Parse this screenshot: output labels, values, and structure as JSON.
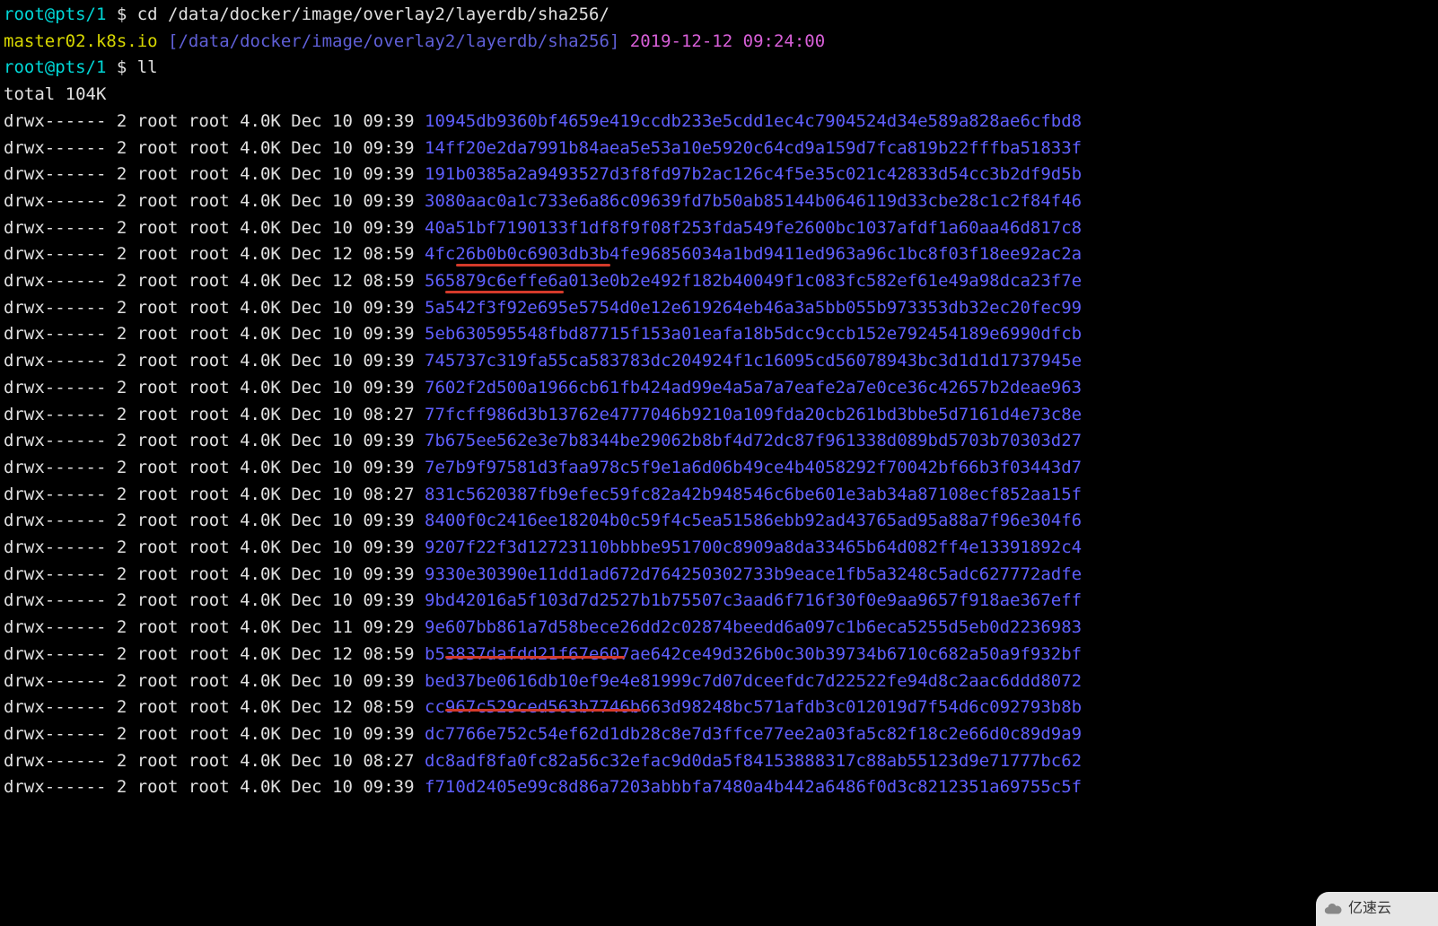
{
  "prompt1": {
    "userhost": "root@pts/1",
    "dollar": " $ ",
    "cmd": "cd /data/docker/image/overlay2/layerdb/sha256/"
  },
  "status": {
    "host": "master02.k8s.io",
    "path": " [/data/docker/image/overlay2/layerdb/sha256]",
    "ts": " 2019-12-12 09:24:00"
  },
  "prompt2": {
    "userhost": "root@pts/1",
    "dollar": " $ ",
    "cmd": "ll"
  },
  "total": "total 104K",
  "cols_prefix": "drwx------ 2 root root 4.0K ",
  "rows": [
    {
      "dt": "Dec 10 09:39 ",
      "h": "10945db9360bf4659e419ccdb233e5cdd1ec4c7904524d34e589a828ae6cfbd8"
    },
    {
      "dt": "Dec 10 09:39 ",
      "h": "14ff20e2da7991b84aea5e53a10e5920c64cd9a159d7fca819b22fffba51833f"
    },
    {
      "dt": "Dec 10 09:39 ",
      "h": "191b0385a2a9493527d3f8fd97b2ac126c4f5e35c021c42833d54cc3b2df9d5b"
    },
    {
      "dt": "Dec 10 09:39 ",
      "h": "3080aac0a1c733e6a86c09639fd7b50ab85144b0646119d33cbe28c1c2f84f46"
    },
    {
      "dt": "Dec 10 09:39 ",
      "h": "40a51bf7190133f1df8f9f08f253fda549fe2600bc1037afdf1a60aa46d817c8"
    },
    {
      "dt": "Dec 12 08:59 ",
      "h": "4fc26b0b0c6903db3b4fe96856034a1bd9411ed963a96c1bc8f03f18ee92ac2a"
    },
    {
      "dt": "Dec 12 08:59 ",
      "h": "565879c6effe6a013e0b2e492f182b40049f1c083fc582ef61e49a98dca23f7e"
    },
    {
      "dt": "Dec 10 09:39 ",
      "h": "5a542f3f92e695e5754d0e12e619264eb46a3a5bb055b973353db32ec20fec99"
    },
    {
      "dt": "Dec 10 09:39 ",
      "h": "5eb630595548fbd87715f153a01eafa18b5dcc9ccb152e792454189e6990dfcb"
    },
    {
      "dt": "Dec 10 09:39 ",
      "h": "745737c319fa55ca583783dc204924f1c16095cd56078943bc3d1d1d1737945e"
    },
    {
      "dt": "Dec 10 09:39 ",
      "h": "7602f2d500a1966cb61fb424ad99e4a5a7a7eafe2a7e0ce36c42657b2deae963"
    },
    {
      "dt": "Dec 10 08:27 ",
      "h": "77fcff986d3b13762e4777046b9210a109fda20cb261bd3bbe5d7161d4e73c8e"
    },
    {
      "dt": "Dec 10 09:39 ",
      "h": "7b675ee562e3e7b8344be29062b8bf4d72dc87f961338d089bd5703b70303d27"
    },
    {
      "dt": "Dec 10 09:39 ",
      "h": "7e7b9f97581d3faa978c5f9e1a6d06b49ce4b4058292f70042bf66b3f03443d7"
    },
    {
      "dt": "Dec 10 08:27 ",
      "h": "831c5620387fb9efec59fc82a42b948546c6be601e3ab34a87108ecf852aa15f"
    },
    {
      "dt": "Dec 10 09:39 ",
      "h": "8400f0c2416ee18204b0c59f4c5ea51586ebb92ad43765ad95a88a7f96e304f6"
    },
    {
      "dt": "Dec 10 09:39 ",
      "h": "9207f22f3d12723110bbbbe951700c8909a8da33465b64d082ff4e13391892c4"
    },
    {
      "dt": "Dec 10 09:39 ",
      "h": "9330e30390e11dd1ad672d764250302733b9eace1fb5a3248c5adc627772adfe"
    },
    {
      "dt": "Dec 10 09:39 ",
      "h": "9bd42016a5f103d7d2527b1b75507c3aad6f716f30f0e9aa9657f918ae367eff"
    },
    {
      "dt": "Dec 11 09:29 ",
      "h": "9e607bb861a7d58bece26dd2c02874beedd6a097c1b6eca5255d5eb0d2236983"
    },
    {
      "dt": "Dec 12 08:59 ",
      "h": "b53837dafdd21f67e607ae642ce49d326b0c30b39734b6710c682a50a9f932bf"
    },
    {
      "dt": "Dec 10 09:39 ",
      "h": "bed37be0616db10ef9e4e81999c7d07dceefdc7d22522fe94d8c2aac6ddd8072"
    },
    {
      "dt": "Dec 12 08:59 ",
      "h": "cc967c529ced563b7746b663d98248bc571afdb3c012019d7f54d6c092793b8b"
    },
    {
      "dt": "Dec 10 09:39 ",
      "h": "dc7766e752c54ef62d1db28c8e7d3ffce77ee2a03fa5c82f18c2e66d0c89d9a9"
    },
    {
      "dt": "Dec 10 08:27 ",
      "h": "dc8adf8fa0fc82a56c32efac9d0da5f84153888317c88ab55123d9e71777bc62"
    },
    {
      "dt": "Dec 10 09:39 ",
      "h": "f710d2405e99c8d86a7203abbbfa7480a4b442a6486f0d3c8212351a69755c5f"
    }
  ],
  "watermark": "亿速云"
}
